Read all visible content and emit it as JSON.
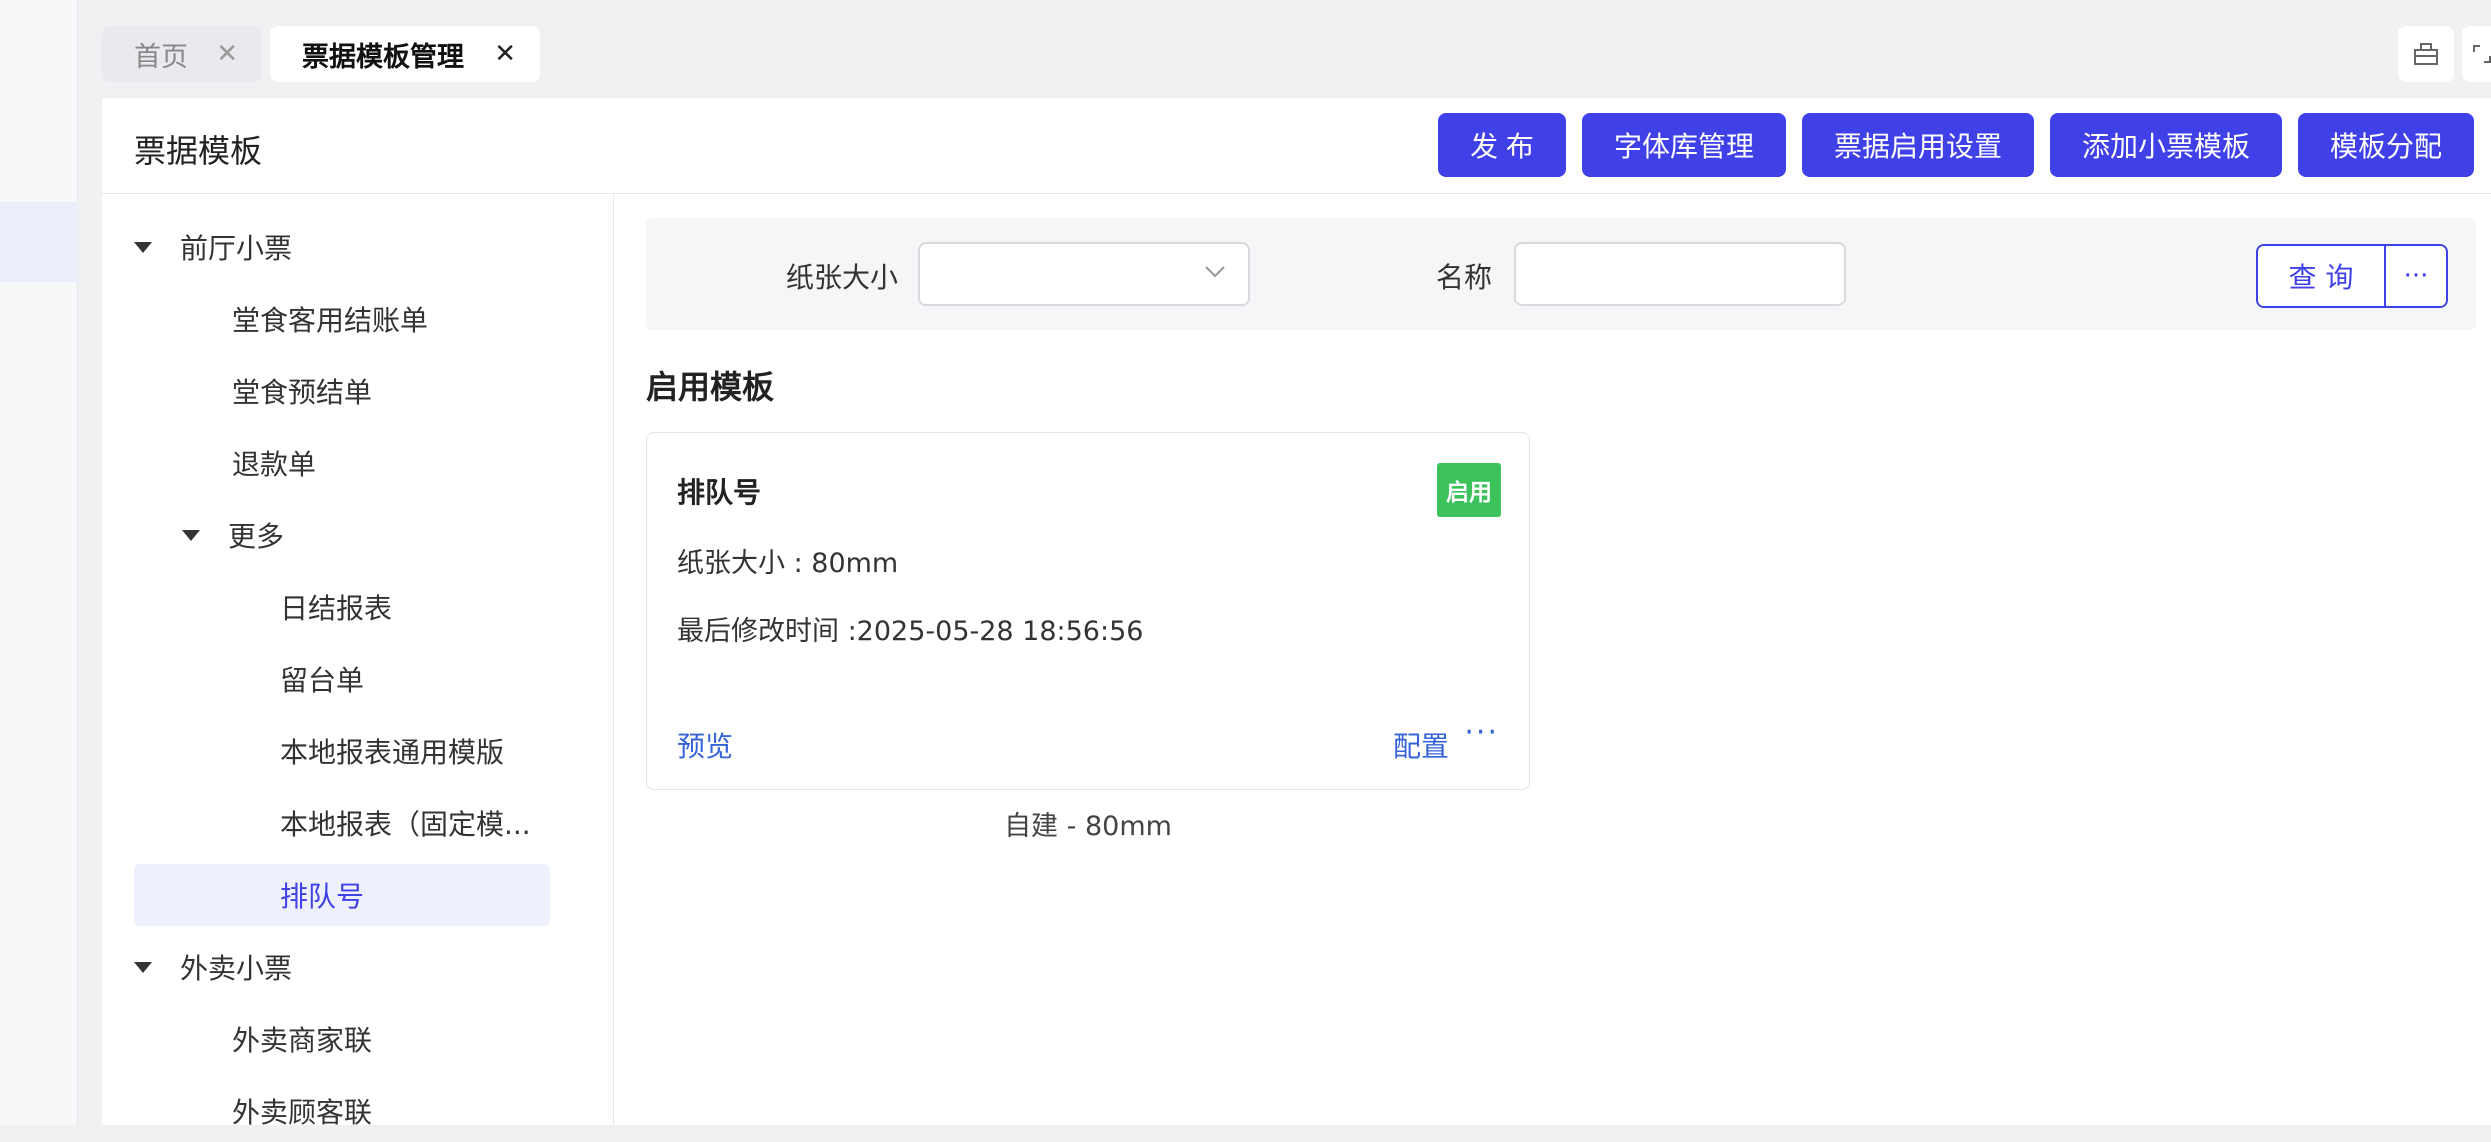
{
  "tabs": [
    {
      "label": "首页",
      "active": false
    },
    {
      "label": "票据模板管理",
      "active": true
    }
  ],
  "tab_close_glyph": "✕",
  "icons": {
    "window": "window-icon",
    "expand": "expand-icon"
  },
  "panel": {
    "title": "票据模板"
  },
  "header_buttons": {
    "publish": "发 布",
    "font_library": "字体库管理",
    "enable_settings": "票据启用设置",
    "add_template": "添加小票模板",
    "assign": "模板分配"
  },
  "tree": {
    "front_hall": "前厅小票",
    "dine_checkout": "堂食客用结账单",
    "dine_pre": "堂食预结单",
    "refund": "退款单",
    "more": "更多",
    "daily_report": "日结报表",
    "store_slip": "留台单",
    "local_generic": "本地报表通用模版",
    "local_fixed": "本地报表（固定模...",
    "queue": "排队号",
    "takeout": "外卖小票",
    "takeout_merchant": "外卖商家联",
    "takeout_customer": "外卖顾客联"
  },
  "filter": {
    "paper_label": "纸张大小",
    "paper_value": "",
    "name_label": "名称",
    "name_value": "",
    "query": "查 询",
    "more": "···"
  },
  "section_title": "启用模板",
  "card": {
    "title": "排队号",
    "badge": "启用",
    "badge_color": "#3cc25a",
    "paper": "纸张大小 : 80mm",
    "modified": "最后修改时间 :2025-05-28 18:56:56",
    "preview": "预览",
    "config": "配置",
    "more": "···",
    "caption": "自建 - 80mm"
  },
  "colors": {
    "accent": "#4040e8",
    "link": "#3563d9"
  }
}
